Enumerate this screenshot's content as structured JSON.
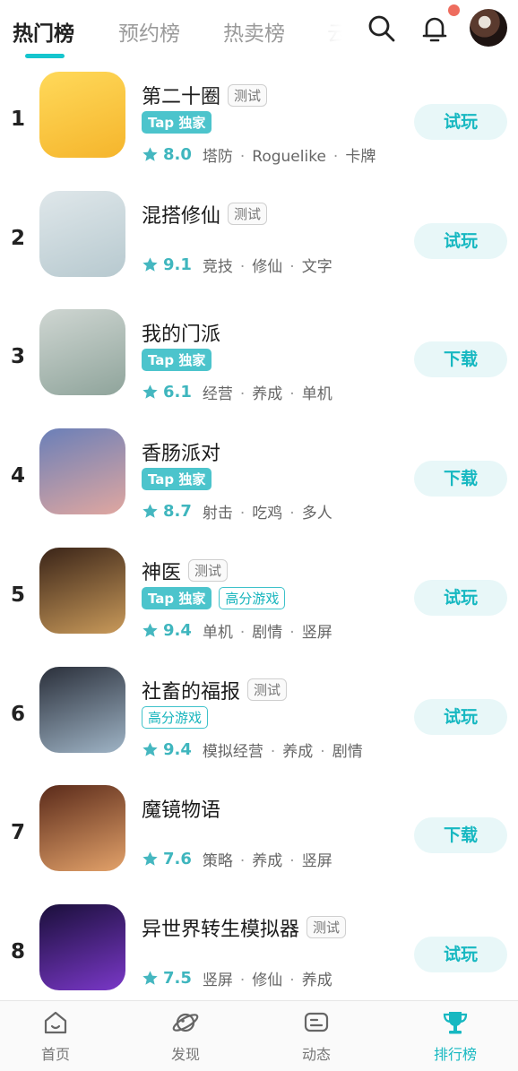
{
  "tabs": [
    {
      "label": "热门榜",
      "active": true
    },
    {
      "label": "预约榜",
      "active": false
    },
    {
      "label": "热卖榜",
      "active": false
    },
    {
      "label": "云",
      "active": false
    }
  ],
  "header_icons": [
    "search-icon",
    "bell-icon",
    "avatar"
  ],
  "games": [
    {
      "rank": "1",
      "name": "第二十圈",
      "test": "测试",
      "tags": [
        "Tap 独家"
      ],
      "rating": "8.0",
      "cats": [
        "塔防",
        "Roguelike",
        "卡牌"
      ],
      "action": "试玩"
    },
    {
      "rank": "2",
      "name": "混搭修仙",
      "test": "测试",
      "tags": [],
      "rating": "9.1",
      "cats": [
        "竞技",
        "修仙",
        "文字"
      ],
      "action": "试玩"
    },
    {
      "rank": "3",
      "name": "我的门派",
      "test": "",
      "tags": [
        "Tap 独家"
      ],
      "rating": "6.1",
      "cats": [
        "经营",
        "养成",
        "单机"
      ],
      "action": "下载"
    },
    {
      "rank": "4",
      "name": "香肠派对",
      "test": "",
      "tags": [
        "Tap 独家"
      ],
      "rating": "8.7",
      "cats": [
        "射击",
        "吃鸡",
        "多人"
      ],
      "action": "下载"
    },
    {
      "rank": "5",
      "name": "神医",
      "test": "测试",
      "tags": [
        "Tap 独家",
        "高分游戏"
      ],
      "rating": "9.4",
      "cats": [
        "单机",
        "剧情",
        "竖屏"
      ],
      "action": "试玩"
    },
    {
      "rank": "6",
      "name": "社畜的福报",
      "test": "测试",
      "tags": [
        "高分游戏"
      ],
      "rating": "9.4",
      "cats": [
        "模拟经营",
        "养成",
        "剧情"
      ],
      "action": "试玩"
    },
    {
      "rank": "7",
      "name": "魔镜物语",
      "test": "",
      "tags": [],
      "rating": "7.6",
      "cats": [
        "策略",
        "养成",
        "竖屏"
      ],
      "action": "下载"
    },
    {
      "rank": "8",
      "name": "异世界转生模拟器",
      "test": "测试",
      "tags": [],
      "rating": "7.5",
      "cats": [
        "竖屏",
        "修仙",
        "养成"
      ],
      "action": "试玩"
    }
  ],
  "nav": [
    {
      "label": "首页",
      "icon": "home-icon",
      "active": false
    },
    {
      "label": "发现",
      "icon": "planet-icon",
      "active": false
    },
    {
      "label": "动态",
      "icon": "chat-icon",
      "active": false
    },
    {
      "label": "排行榜",
      "icon": "trophy-icon",
      "active": true
    }
  ],
  "colors": {
    "accent": "#15c5ce",
    "badge_dot": "#ee6c5e",
    "rating": "#3fb6be",
    "button_bg": "#e8f7f8"
  }
}
